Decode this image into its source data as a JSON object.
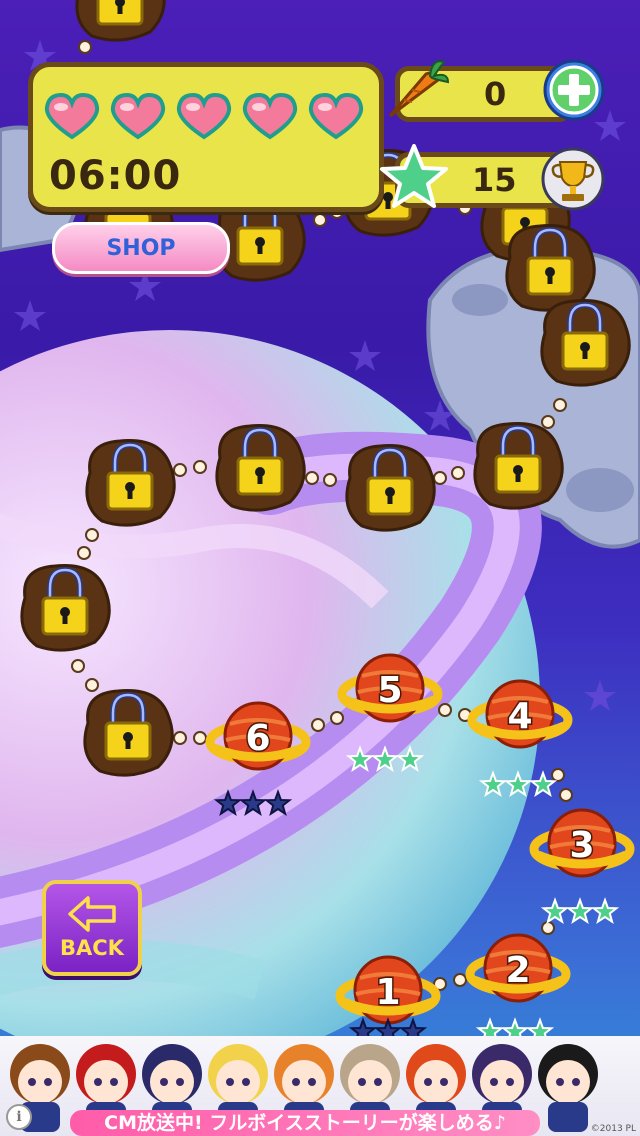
{
  "hud": {
    "lives_count": 5,
    "timer": "06:00",
    "carrot_count": "0",
    "star_total": "15"
  },
  "buttons": {
    "shop_label": "SHOP",
    "back_label": "BACK"
  },
  "levels": [
    {
      "number": "1",
      "stars": 0
    },
    {
      "number": "2",
      "stars": 3
    },
    {
      "number": "3",
      "stars": 3
    },
    {
      "number": "4",
      "stars": 3
    },
    {
      "number": "5",
      "stars": 3
    },
    {
      "number": "6",
      "stars": 0
    }
  ],
  "locked_level_count": 13,
  "ad_banner": {
    "caption": "CM放送中! フルボイスストーリーが楽しめる♪",
    "copyright": "©2013 PL"
  },
  "icons": [
    "heart-icon",
    "carrot-icon",
    "plus-icon",
    "star-icon",
    "trophy-icon",
    "lock-icon",
    "planet-level-icon",
    "back-arrow-icon",
    "info-icon"
  ],
  "colors": {
    "hud_panel": "#e9e44a",
    "hud_border": "#6b4a1a",
    "star_earned": "#4fd08a",
    "star_empty": "#2a3a8a",
    "planet": "#e2461c"
  }
}
